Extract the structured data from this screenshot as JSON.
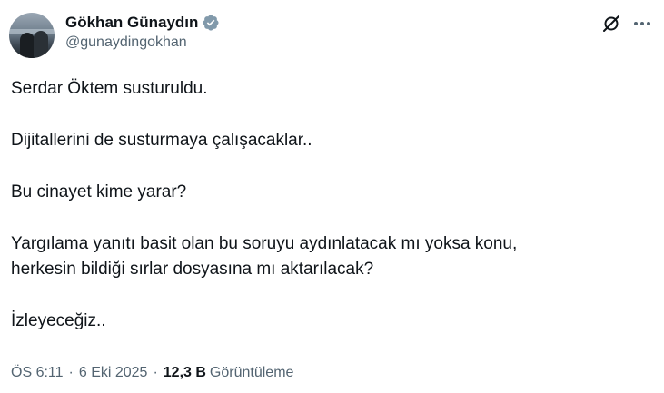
{
  "author": {
    "display_name": "Gökhan Günaydın",
    "handle": "@gunaydingokhan",
    "verified_icon": "verified-badge-icon"
  },
  "header_actions": {
    "grok_icon": "grok-icon",
    "more_icon": "more-options-icon"
  },
  "tweet": {
    "paragraphs": [
      "Serdar Öktem susturuldu.",
      "Dijitallerini de susturmaya çalışacaklar..",
      "Bu cinayet kime yarar?",
      "Yargılama yanıtı basit olan bu soruyu aydınlatacak mı yoksa konu,\nherkesin bildiği sırlar dosyasına mı aktarılacak?",
      "İzleyeceğiz.."
    ]
  },
  "meta": {
    "time": "ÖS 6:11",
    "date": "6 Eki 2025",
    "separator": "·",
    "views_count": "12,3 B",
    "views_label": "Görüntüleme"
  },
  "colors": {
    "text_primary": "#0f1419",
    "text_secondary": "#536471",
    "verified": "#829aab"
  }
}
